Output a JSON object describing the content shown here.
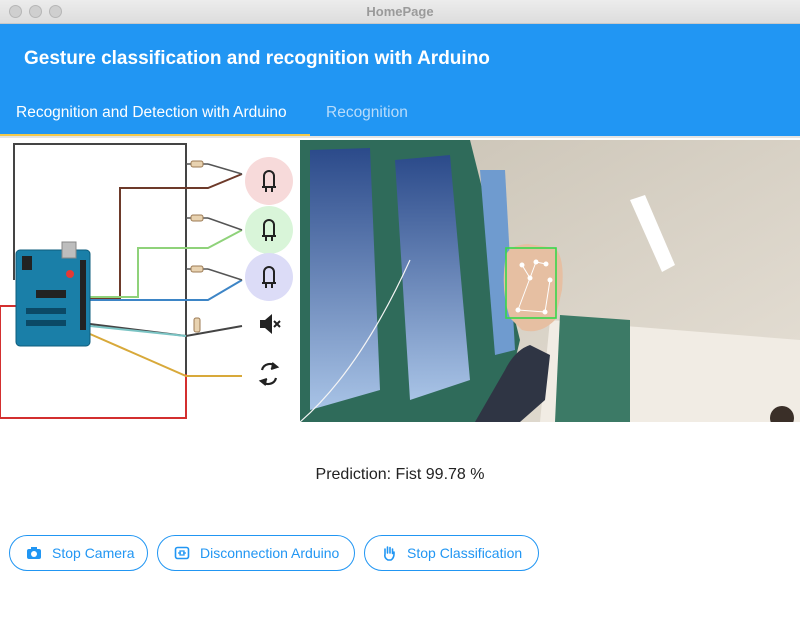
{
  "window": {
    "title": "HomePage"
  },
  "appbar": {
    "title": "Gesture classification and recognition with Arduino"
  },
  "tabs": [
    {
      "label": "Recognition and Detection with Arduino",
      "active": true
    },
    {
      "label": "Recognition",
      "active": false
    }
  ],
  "circuit": {
    "outputs": [
      {
        "icon": "led-icon",
        "color": "#f7dada"
      },
      {
        "icon": "led-icon",
        "color": "#d9f5d9"
      },
      {
        "icon": "led-icon",
        "color": "#dcdcf7"
      },
      {
        "icon": "speaker-mute-icon"
      },
      {
        "icon": "rotate-icon"
      }
    ]
  },
  "camera": {
    "detected_gesture": "Fist"
  },
  "prediction": {
    "text": "Prediction: Fist 99.78 %"
  },
  "buttons": [
    {
      "label": "Stop Camera",
      "icon": "camera-icon"
    },
    {
      "label": "Disconnection Arduino",
      "icon": "link-icon"
    },
    {
      "label": "Stop Classification",
      "icon": "hand-icon"
    }
  ],
  "colors": {
    "primary": "#2196f3",
    "accent": "#f2c94c"
  }
}
